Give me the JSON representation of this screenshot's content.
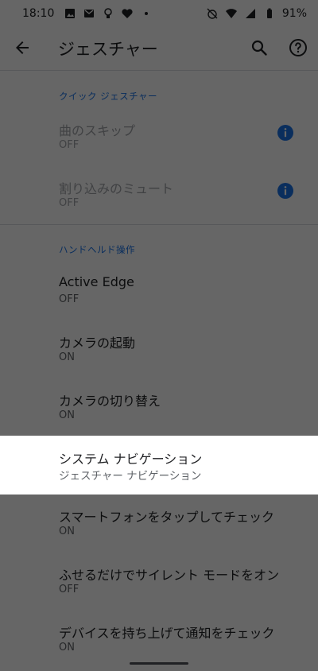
{
  "status_bar": {
    "time": "18:10",
    "battery": "91%",
    "left_icons": [
      "image-icon",
      "mail-icon",
      "bulb-icon",
      "heart-icon",
      "dot-icon"
    ],
    "right_icons": [
      "alarm-off-icon",
      "wifi-icon",
      "signal-icon",
      "battery-icon"
    ]
  },
  "appbar": {
    "title": "ジェスチャー",
    "icons": [
      "back-arrow-icon",
      "search-icon",
      "help-icon"
    ]
  },
  "sections": [
    {
      "header": "クイック ジェスチャー",
      "items": [
        {
          "title": "曲のスキップ",
          "subtitle": "OFF",
          "disabled": true,
          "info": true
        },
        {
          "title": "割り込みのミュート",
          "subtitle": "OFF",
          "disabled": true,
          "info": true
        }
      ]
    },
    {
      "header": "ハンドヘルド操作",
      "items": [
        {
          "title": "Active Edge",
          "subtitle": "OFF"
        },
        {
          "title": "カメラの起動",
          "subtitle": "ON"
        },
        {
          "title": "カメラの切り替え",
          "subtitle": "ON"
        },
        {
          "title": "システム ナビゲーション",
          "subtitle": "ジェスチャー ナビゲーション",
          "highlighted": true
        },
        {
          "title": "スマートフォンをタップしてチェック",
          "subtitle": "ON"
        },
        {
          "title": "ふせるだけでサイレント モードをオン",
          "subtitle": "OFF"
        },
        {
          "title": "デバイスを持ち上げて通知をチェック",
          "subtitle": "ON"
        }
      ]
    }
  ],
  "colors": {
    "accent": "#1a73e8",
    "info_icon": "#1a73e8",
    "scrim": "#000000"
  }
}
